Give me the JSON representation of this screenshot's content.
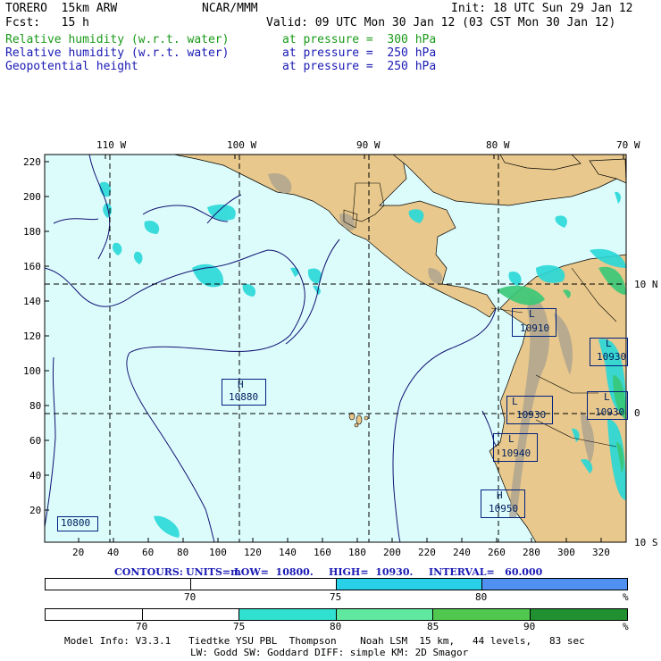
{
  "header": {
    "model": "TORERO  15km ARW",
    "org": "NCAR/MMM",
    "init": "Init: 18 UTC Sun 29 Jan 12",
    "fcst": "Fcst:   15 h",
    "valid": "Valid: 09 UTC Mon 30 Jan 12 (03 CST Mon 30 Jan 12)",
    "fields": [
      {
        "name": "Relative humidity (w.r.t. water)",
        "level": "at pressure =  300 hPa",
        "color": "#1a9a1a"
      },
      {
        "name": "Relative humidity (w.r.t. water)",
        "level": "at pressure =  250 hPa",
        "color": "#1a1ab4"
      },
      {
        "name": "Geopotential height",
        "level": "at pressure =  250 hPa",
        "color": "#1a1ab4"
      }
    ]
  },
  "map": {
    "top_lon_labels": [
      "110 W",
      "100 W",
      "90 W",
      "80 W",
      "70 W"
    ],
    "right_lat_labels": [
      "10 N",
      "0",
      "10 S"
    ],
    "y_ticks": [
      "220",
      "200",
      "180",
      "160",
      "140",
      "120",
      "100",
      "80",
      "60",
      "40",
      "20"
    ],
    "x_ticks": [
      "20",
      "40",
      "60",
      "80",
      "100",
      "120",
      "140",
      "160",
      "180",
      "200",
      "220",
      "240",
      "260",
      "280",
      "300",
      "320"
    ],
    "highs_lows": [
      {
        "type": "H",
        "value": "10880"
      },
      {
        "type": "L",
        "value": "10910"
      },
      {
        "type": "L",
        "value": "10930"
      },
      {
        "type": "L",
        "value": "10930"
      },
      {
        "type": "L",
        "value": "10930"
      },
      {
        "type": "L",
        "value": "10940"
      },
      {
        "type": "H",
        "value": "10950"
      },
      {
        "type": "",
        "value": "10800"
      }
    ],
    "colors": {
      "ocean": "#dcfcfc",
      "land": "#e8c88c",
      "terrain": "#a09a88",
      "rh_cyan": "#28d8d8",
      "rh_green": "#38c878"
    }
  },
  "contours_line": {
    "contours": "CONTOURS:",
    "units": "UNITS=m",
    "low": "LOW=  10800.",
    "high": "HIGH=  10930.",
    "interval": "INTERVAL=   60.000"
  },
  "legend1": {
    "labels": [
      "70",
      "75",
      "80",
      "%"
    ],
    "colors": [
      "#ffffff",
      "#ffffff",
      "#28d0e8",
      "#5090f0"
    ]
  },
  "legend2": {
    "labels": [
      "70",
      "75",
      "80",
      "85",
      "90",
      "%"
    ],
    "colors": [
      "#ffffff",
      "#ffffff",
      "#30e0d0",
      "#60e8a0",
      "#50c850",
      "#209030"
    ]
  },
  "footer": {
    "line1": "Model Info: V3.3.1   Tiedtke YSU PBL  Thompson    Noah LSM  15 km,   44 levels,   83 sec",
    "line2": "LW: Godd SW: Goddard DIFF: simple KM: 2D Smagor"
  }
}
